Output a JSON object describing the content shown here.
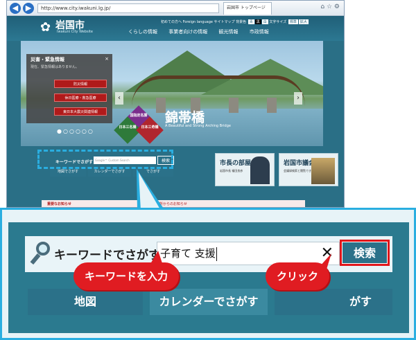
{
  "browser": {
    "address": "http://www.city.iwakuni.lg.jp/",
    "tab_title": "岩国市 トップページ",
    "back_icon": "arrow-left-icon",
    "forward_icon": "arrow-right-icon"
  },
  "site": {
    "logo": "岩国市",
    "logo_sub": "Iwakuni City Website",
    "utility": "初めての方へ  Foreign language  サイトマップ  背景色",
    "util_buttons": [
      "青",
      "黒",
      "白"
    ],
    "text_size_label": "文字サイズ",
    "text_buttons": [
      "標準",
      "拡大"
    ],
    "nav": [
      "くらしの情報",
      "事業者向けの情報",
      "観光情報",
      "市政情報"
    ]
  },
  "disaster": {
    "title": "災害・緊急情報",
    "close": "×",
    "message": "現在、緊急情報はありません。",
    "buttons": [
      "防災情報",
      "休日医療・救急医療",
      "東日本大震災関連情報"
    ]
  },
  "hero": {
    "title": "錦帯橋",
    "subtitle": "A Beautiful and Strong Arching Bridge",
    "badges": [
      "国指定名勝",
      "日本三名橋",
      "日本三奇橋"
    ]
  },
  "mini_search": {
    "label": "キーワードでさがす",
    "placeholder": "Google™ Custom Search",
    "button": "検索",
    "sub_buttons": [
      "地図でさがす",
      "カレンダーでさがす",
      "でさがす"
    ]
  },
  "cards": [
    {
      "title": "市長の部屋",
      "sub": "岩国市長  福田良彦"
    },
    {
      "title": "岩国市議会",
      "sub": "会議録検索と閲覧できます"
    }
  ],
  "notices": [
    "重要なお知らせ",
    "岩国市役所からのお知らせ"
  ],
  "zoom": {
    "label": "キーワードでさがす",
    "input_value": "子育て 支援",
    "clear_icon": "close-icon",
    "button": "検索",
    "sub_buttons": [
      "地図",
      "カレンダーでさがす",
      "がす"
    ]
  },
  "annotations": {
    "type_keyword": "キーワードを入力",
    "click": "クリック"
  },
  "colors": {
    "accent": "#2aaee0",
    "button": "#2b7189",
    "alert": "#e01c22"
  }
}
